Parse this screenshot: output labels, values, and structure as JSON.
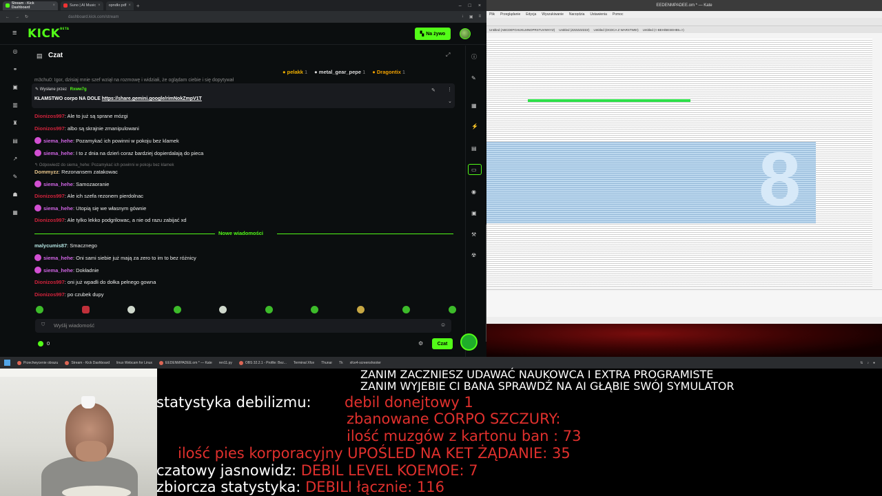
{
  "browser": {
    "tabs": [
      {
        "label": "Stream - Kick Dashboard"
      },
      {
        "label": "Suno | AI Music"
      },
      {
        "label": "opndkr.pdf"
      }
    ],
    "url": "dashboard.kick.com/stream"
  },
  "kick": {
    "logo": "KICK",
    "logo_tag": "BETA",
    "live_button": "Na żywo"
  },
  "chat": {
    "title": "Czat",
    "top_gifters": [
      {
        "name": "pelakk",
        "count": "1"
      },
      {
        "name": "metal_gear_pepe",
        "count": "1"
      },
      {
        "name": "Dragontix",
        "count": "1"
      }
    ],
    "clipped_line": "m3chu0: Igor, dzisiaj mnie szef wziął na rozmowę i widziałi, że oglądam ciebie i się dopytywał",
    "pinned": {
      "by_label": "Wysłane przez",
      "by_user": "Rxww7g",
      "text": "KŁAMSTWO corpo NA DOLE",
      "link": "https://share.gemini.google/rimNokZmpV1T"
    },
    "messages": [
      {
        "user": "Dionizos997",
        "text": ": Ale to już są sprane mózgi"
      },
      {
        "user": "Dionizos997",
        "text": ": albo są skrajnie zmanipulowani"
      },
      {
        "user": "siema_hehe",
        "text": ": Pozamykać ich powinni w pokoju bez klamek"
      },
      {
        "user": "siema_hehe",
        "text": ": I to z dnia na dzień coraz bardziej dopierdalają do pieca"
      },
      {
        "reply": "Odpowiedź do siema_hehe: Pozamykać ich powinni w pokoju bez klamek"
      },
      {
        "user": "Dommyzz",
        "text": ": Rezonansem zatakowac"
      },
      {
        "user": "siema_hehe",
        "text": ": Samozaoranie"
      },
      {
        "user": "Dionizos997",
        "text": ": Ale ich szefa rezonem pierdolnac"
      },
      {
        "user": "siema_hehe",
        "text": ": Utopią się we własnym gównie"
      },
      {
        "user": "Dionizos997",
        "text": ": Ale tylko lekko podgrilowac, a nie od razu zabijać xd"
      }
    ],
    "new_messages_label": "Nowe wiadomości",
    "new_messages": [
      {
        "user": "malycumis87",
        "text": ": Smacznego"
      },
      {
        "user": "siema_hehe",
        "text": ": Oni sami siebie już mają za zero to im to bez różnicy"
      },
      {
        "user": "siema_hehe",
        "text": ": Dokładnie"
      },
      {
        "user": "Dionizos997",
        "text": ": oni już wpadli do dołka pełnego gowna"
      },
      {
        "user": "Dionizos997",
        "text": ": po czubek dupy"
      }
    ],
    "input_placeholder": "Wyślij wiadomość",
    "points": "0",
    "send_button": "Czat"
  },
  "editor": {
    "window_title": "EEDENMPADEE.om * — Kate",
    "menu": [
      "Plik",
      "Przeglądanie",
      "Edycja",
      "Wyszukiwanie",
      "Narzędzia",
      "Ustawienia",
      "Pomoc"
    ],
    "tabs": [
      "Untitled (ABCDEFGHIJKLMNOPRSTUVWXYZ)",
      "Untitled (ZZZZZZZZZ)",
      "Untitled (DCDCA Z WARSTWE!)",
      "Untitled (<-BEH/BESEHB5=>)"
    ]
  },
  "taskbar": {
    "items": [
      "Przechwycenie obrazu",
      "Stream - Kick Dashboard",
      "linux Webcam for Linux",
      "EEDENMPADEE.om * — Kate",
      "ren11.py",
      "OBS 32.2.1 - Profile: Bez...",
      "Terminal Xfce",
      "Thunar",
      "Tk",
      "xfce4-screenshooter"
    ]
  },
  "overlay": {
    "line1": "ZANIM ZACZNIESZ UDAWAĆ NAUKOWCA I EXTRA PROGRAMISTE",
    "line2": "ZANIM WYJEBIE CI BANA SPRAWDŹ NA AI GŁĄBIE SWÓJ SYMULATOR",
    "stats_label": "statystyka debilizmu:",
    "stat1": "debil donejtowy 1",
    "stat2": "zbanowane CORPO SZCZURY:",
    "stat3": "ilość muzgów z kartonu ban : 73",
    "stat4": "ilość pies korporacyjny UPOŚLED NA KET ŻĄDANIE: 35",
    "stat5_label": "czatowy jasnowidz:",
    "stat5_value": "DEBIL LEVEL KOEMOE: 7",
    "stat6_label": "zbiorcza statystyka:",
    "stat6_value": "DEBILI łącznie: 116"
  }
}
